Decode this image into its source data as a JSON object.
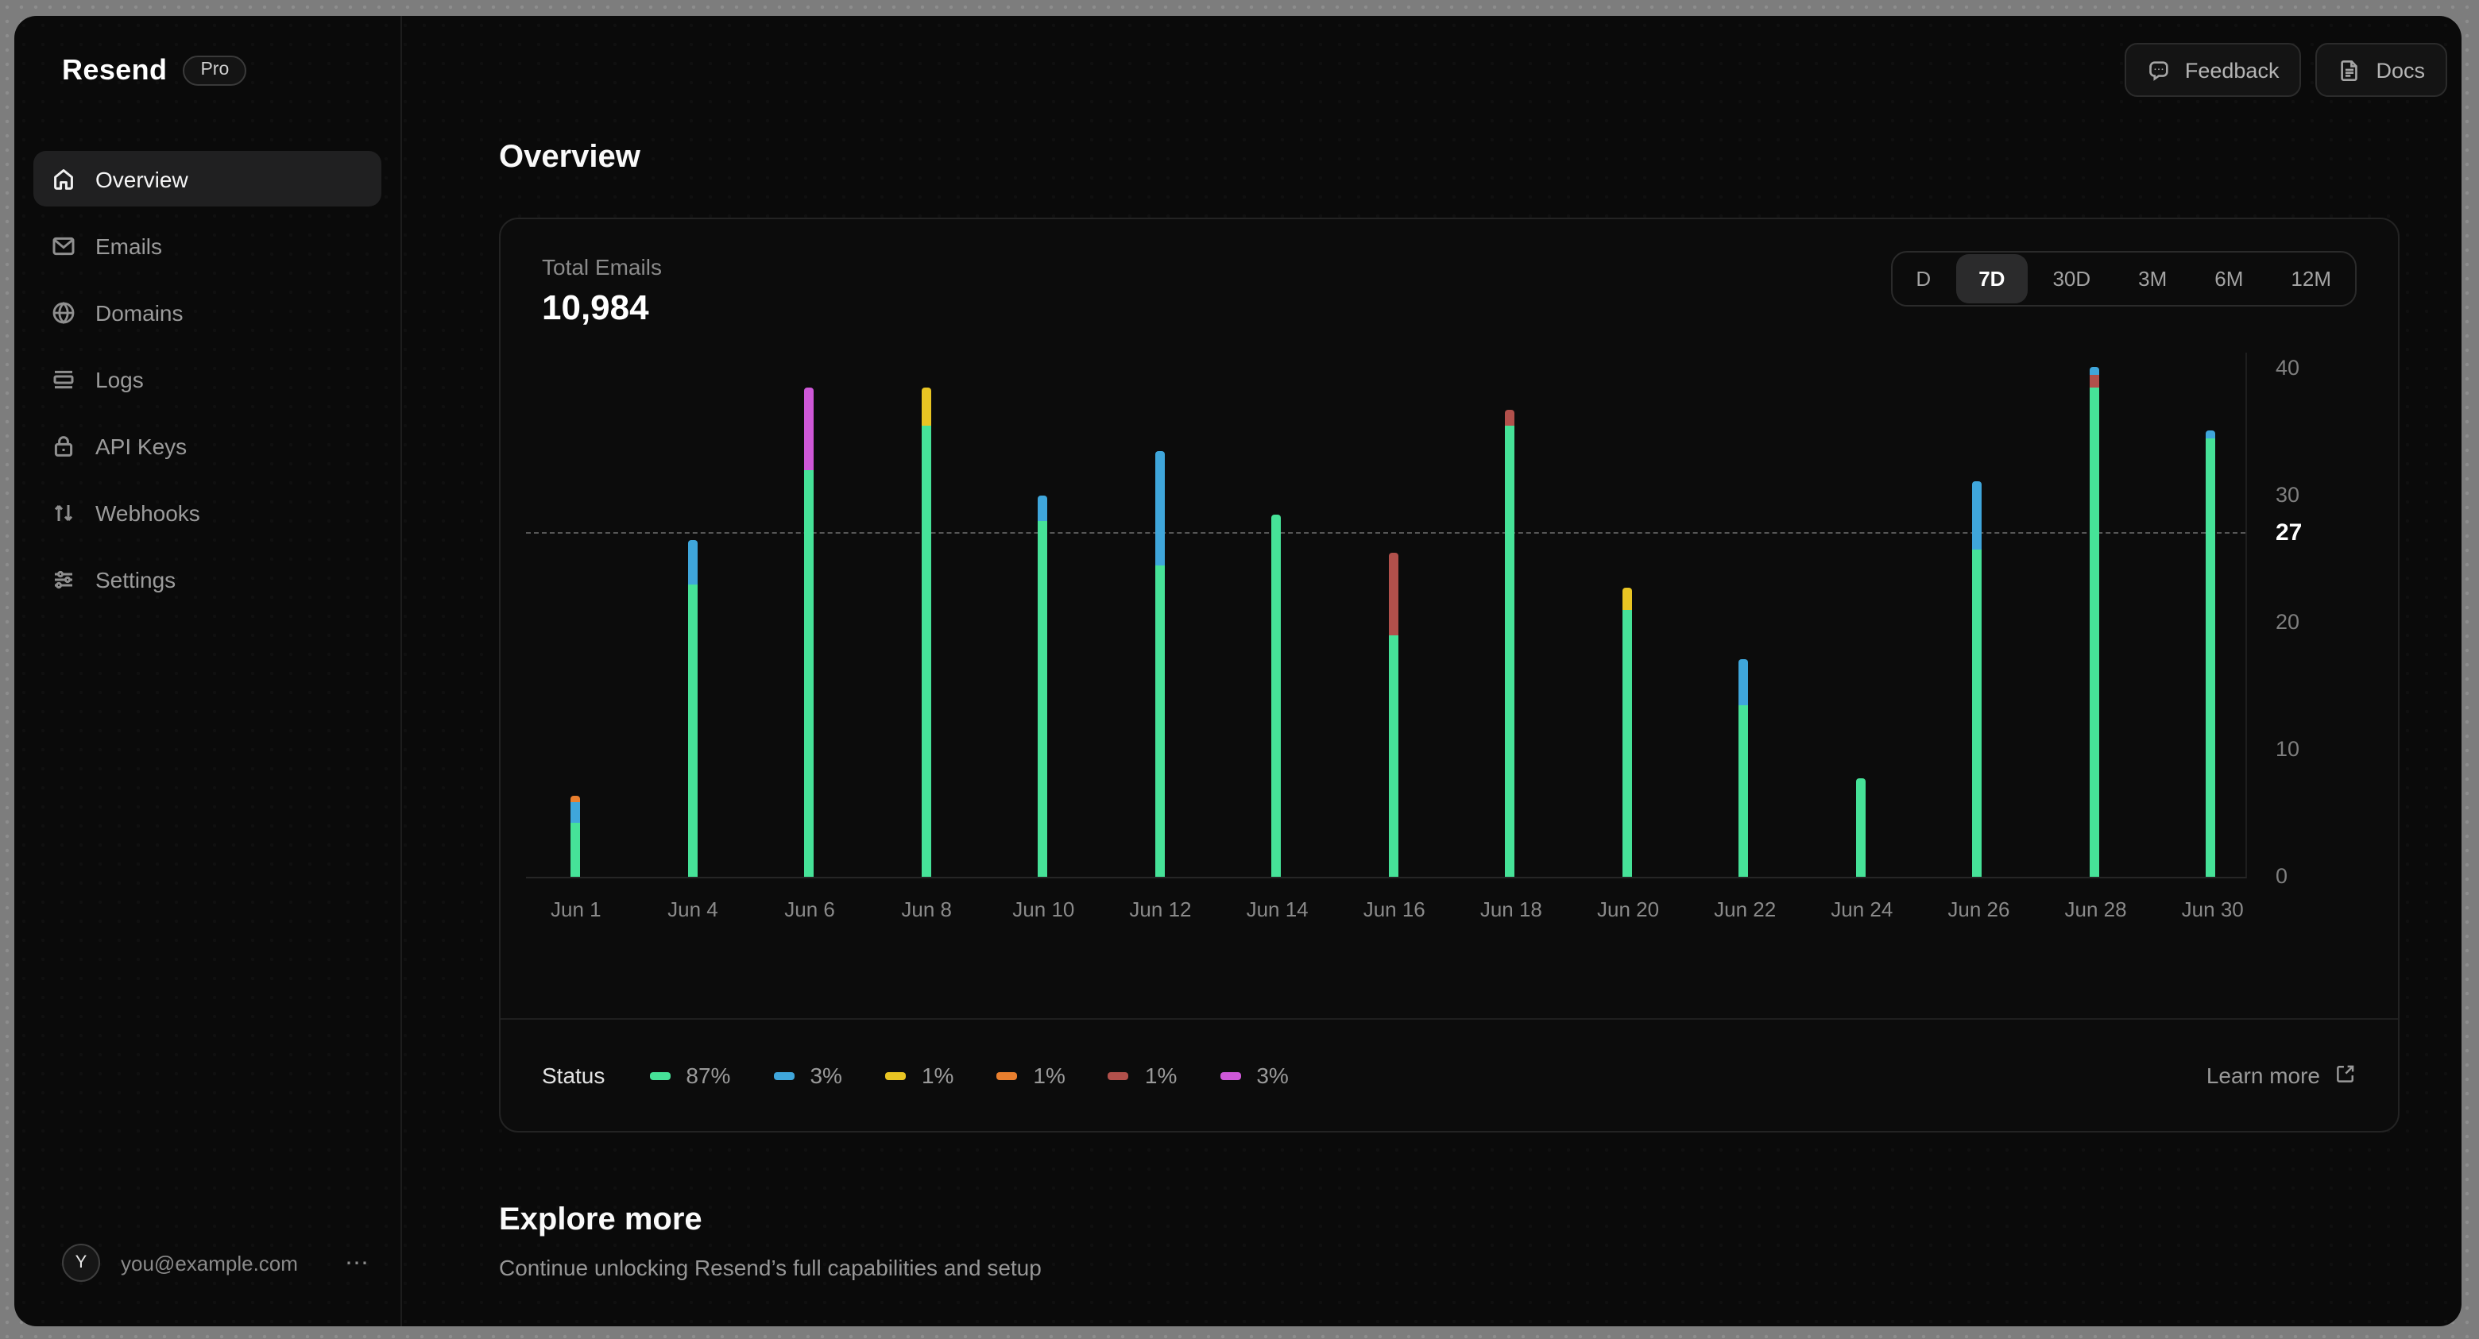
{
  "window": {
    "brand": "Resend",
    "plan_badge": "Pro"
  },
  "sidebar": {
    "items": [
      {
        "label": "Overview",
        "icon": "home-icon",
        "active": true
      },
      {
        "label": "Emails",
        "icon": "mail-icon",
        "active": false
      },
      {
        "label": "Domains",
        "icon": "globe-icon",
        "active": false
      },
      {
        "label": "Logs",
        "icon": "logs-icon",
        "active": false
      },
      {
        "label": "API Keys",
        "icon": "lock-icon",
        "active": false
      },
      {
        "label": "Webhooks",
        "icon": "arrows-up-down-icon",
        "active": false
      },
      {
        "label": "Settings",
        "icon": "sliders-icon",
        "active": false
      }
    ],
    "user": {
      "avatar_initial": "Y",
      "email": "you@example.com",
      "menu": "⋯"
    }
  },
  "header": {
    "feedback_label": "Feedback",
    "docs_label": "Docs"
  },
  "page": {
    "title": "Overview"
  },
  "card": {
    "metric_label": "Total Emails",
    "metric_value": "10,984",
    "range_options": [
      "D",
      "7D",
      "30D",
      "3M",
      "6M",
      "12M"
    ],
    "range_selected": "7D",
    "legend_title": "Status",
    "learn_more": "Learn more"
  },
  "chart_data": {
    "type": "stacked-bar",
    "title": "Total Emails",
    "total_label": "10,984",
    "x_labels": [
      "Jun 1",
      "Jun 4",
      "Jun 6",
      "Jun 8",
      "Jun 10",
      "Jun 12",
      "Jun 14",
      "Jun 16",
      "Jun 18",
      "Jun 20",
      "Jun 22",
      "Jun 24",
      "Jun 26",
      "Jun 28",
      "Jun 30"
    ],
    "ylim": [
      0,
      41.25
    ],
    "yticks": [
      0,
      10,
      20,
      30,
      40
    ],
    "reference_line": 27,
    "grid": "off",
    "legend_position": "bottom",
    "stack_order": [
      0,
      4,
      2,
      5,
      1,
      3
    ],
    "series": [
      {
        "name": "status-green",
        "pct": "87%",
        "color": "#46e298",
        "values": [
          4.3,
          23,
          32,
          35.5,
          28,
          24.5,
          28.5,
          19,
          35.5,
          21,
          13.5,
          7.7,
          25.8,
          38.5,
          34.5
        ]
      },
      {
        "name": "status-blue",
        "pct": "3%",
        "color": "#3fa6db",
        "values": [
          1.6,
          3.5,
          0,
          0,
          2,
          9,
          0,
          0,
          0,
          0,
          3.6,
          0,
          5.3,
          0.6,
          0.6
        ]
      },
      {
        "name": "status-yellow",
        "pct": "1%",
        "color": "#e9c523",
        "values": [
          0,
          0,
          0,
          3,
          0,
          0,
          0,
          0,
          0,
          1.7,
          0,
          0,
          0,
          0,
          0
        ]
      },
      {
        "name": "status-orange",
        "pct": "1%",
        "color": "#e97f2e",
        "values": [
          0.5,
          0,
          0,
          0,
          0,
          0,
          0,
          0,
          0,
          0,
          0,
          0,
          0,
          0,
          0
        ],
        "textured": true
      },
      {
        "name": "status-red",
        "pct": "1%",
        "color": "#b1504b",
        "values": [
          0,
          0,
          0,
          0,
          0,
          0,
          0,
          6.5,
          1.2,
          0,
          0,
          0,
          0,
          1,
          0
        ]
      },
      {
        "name": "status-magenta",
        "pct": "3%",
        "color": "#ce58d8",
        "values": [
          0,
          0,
          6.5,
          0,
          0,
          0,
          0,
          0,
          0,
          0,
          0,
          0,
          0,
          0,
          0
        ]
      }
    ]
  },
  "explore": {
    "title": "Explore more",
    "subtitle": "Continue unlocking Resend’s full capabilities and setup"
  }
}
